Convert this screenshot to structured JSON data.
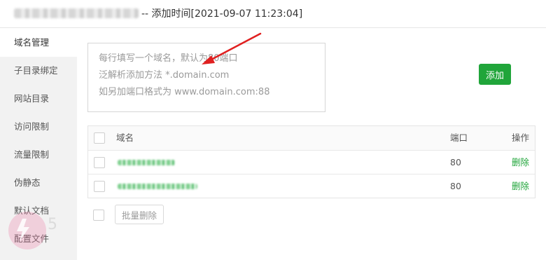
{
  "window": {
    "title": "-- 添加时间[2021-09-07 11:23:04]"
  },
  "sidebar": {
    "items": [
      {
        "label": "域名管理"
      },
      {
        "label": "子目录绑定"
      },
      {
        "label": "网站目录"
      },
      {
        "label": "访问限制"
      },
      {
        "label": "流量限制"
      },
      {
        "label": "伪静态"
      },
      {
        "label": "默认文档"
      },
      {
        "label": "配置文件"
      }
    ]
  },
  "domain_input": {
    "placeholder_lines": [
      "每行填写一个域名，默认为80端口",
      "泛解析添加方法 *.domain.com",
      "如另加端口格式为 www.domain.com:88"
    ],
    "value": ""
  },
  "add_button": {
    "label": "添加"
  },
  "table": {
    "headers": {
      "domain": "域名",
      "port": "端口",
      "action": "操作"
    },
    "rows": [
      {
        "port": "80",
        "action": "删除"
      },
      {
        "port": "80",
        "action": "删除"
      }
    ]
  },
  "batch_delete": {
    "label": "批量删除"
  },
  "colors": {
    "accent": "#20a53a",
    "arrow": "#e02020",
    "sidebar_bg": "#f2f2f2"
  }
}
